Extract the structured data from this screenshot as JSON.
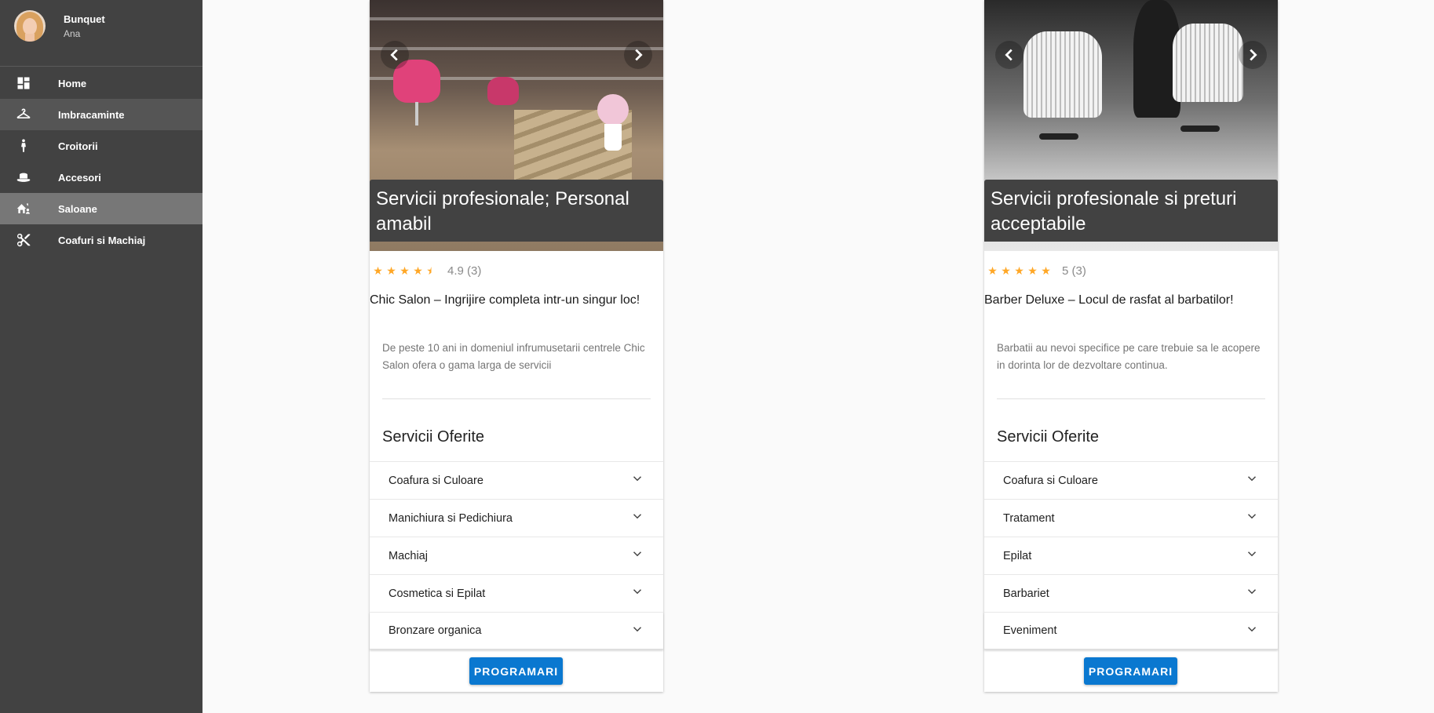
{
  "colors": {
    "sidebar_bg": "#424242",
    "nav_hover": "#555555",
    "nav_active": "#777777",
    "accent": "#0a78d0",
    "star": "#ffa726"
  },
  "profile": {
    "first_name": "Bunquet",
    "last_name": "Ana"
  },
  "sidebar": {
    "items": [
      {
        "label": "Home",
        "icon": "dashboard-icon"
      },
      {
        "label": "Imbracaminte",
        "icon": "hanger-icon"
      },
      {
        "label": "Croitorii",
        "icon": "person-icon"
      },
      {
        "label": "Accesori",
        "icon": "hat-icon"
      },
      {
        "label": "Saloane",
        "icon": "house-people-icon",
        "active": true
      },
      {
        "label": "Coafuri si Machiaj",
        "icon": "scissors-icon"
      }
    ]
  },
  "salons": [
    {
      "caption": "Servicii profesionale; Personal amabil",
      "rating_stars": 4.5,
      "rating_text": "4.9 (3)",
      "title": "Chic Salon – Ingrijire completa intr-un singur loc!",
      "description": "De peste 10 ani in domeniul infrumusetarii centrele Chic Salon ofera o gama larga de servicii",
      "section_title": "Servicii Oferite",
      "services": [
        "Coafura si Culoare",
        "Manichiura si Pedichiura",
        "Machiaj",
        "Cosmetica si Epilat",
        "Bronzare organica"
      ],
      "button": "PROGRAMARI"
    },
    {
      "caption": "Servicii profesionale si preturi acceptabile",
      "rating_stars": 5,
      "rating_text": "5 (3)",
      "title": "Barber Deluxe – Locul de rasfat al barbatilor!",
      "description": "Barbatii au nevoi specifice pe care trebuie sa le acopere in dorinta lor de dezvoltare continua.",
      "section_title": "Servicii Oferite",
      "services": [
        "Coafura si Culoare",
        "Tratament",
        "Epilat",
        "Barbariet",
        "Eveniment"
      ],
      "button": "PROGRAMARI"
    }
  ]
}
